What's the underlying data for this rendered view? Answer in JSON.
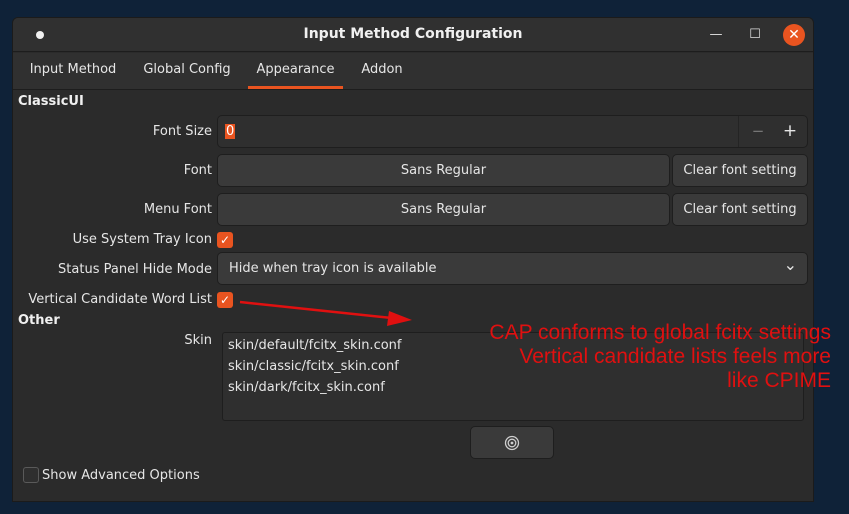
{
  "window": {
    "title": "Input Method Configuration",
    "controls": {
      "minimize": "—",
      "maximize": "☐",
      "close": "✕"
    }
  },
  "tabs": [
    {
      "label": "Input Method"
    },
    {
      "label": "Global Config"
    },
    {
      "label": "Appearance"
    },
    {
      "label": "Addon"
    }
  ],
  "classic_ui": {
    "section_title": "ClassicUI",
    "font_size": {
      "label": "Font Size",
      "value": "0",
      "decrement": "−",
      "increment": "+"
    },
    "font": {
      "label": "Font",
      "value": "Sans Regular",
      "clear_label": "Clear font setting"
    },
    "menu_font": {
      "label": "Menu Font",
      "value": "Sans Regular",
      "clear_label": "Clear font setting"
    },
    "use_system_tray_icon": {
      "label": "Use System Tray Icon",
      "checked": true,
      "check_glyph": "✓"
    },
    "status_panel_hide_mode": {
      "label": "Status Panel Hide Mode",
      "value": "Hide when tray icon is available",
      "arrow": "⌄"
    },
    "vertical_candidate_word_list": {
      "label": "Vertical Candidate Word List",
      "checked": true,
      "check_glyph": "✓"
    }
  },
  "other": {
    "section_title": "Other",
    "skin": {
      "label": "Skin",
      "items": [
        "skin/default/fcitx_skin.conf",
        "skin/classic/fcitx_skin.conf",
        "skin/dark/fcitx_skin.conf"
      ],
      "button_icon": "target-icon"
    }
  },
  "show_advanced_options": {
    "label": "Show Advanced Options",
    "checked": false
  },
  "annotation": {
    "lines": [
      "CAP conforms to global fcitx settings",
      "Vertical candidate lists feels more",
      "like CPIME"
    ],
    "color": "#e01010"
  },
  "colors": {
    "accent": "#e95420",
    "background": "#0f2238",
    "window": "#2b2b2b"
  }
}
